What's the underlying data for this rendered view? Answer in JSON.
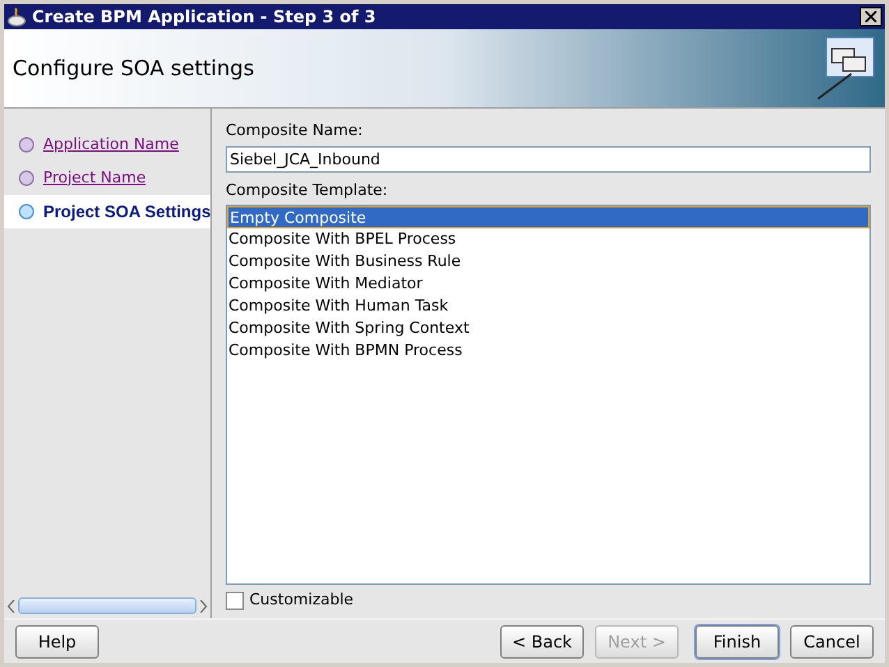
{
  "window": {
    "title": "Create BPM Application - Step 3 of 3"
  },
  "header": {
    "title": "Configure SOA settings"
  },
  "steps": [
    {
      "label": "Application Name",
      "selected": false
    },
    {
      "label": "Project Name",
      "selected": false
    },
    {
      "label": "Project SOA Settings",
      "selected": true
    }
  ],
  "composite_name": {
    "label": "Composite Name:",
    "value": "Siebel_JCA_Inbound"
  },
  "composite_template": {
    "label": "Composite Template:",
    "items": [
      {
        "label": "Empty Composite",
        "selected": true
      },
      {
        "label": "Composite With BPEL Process",
        "selected": false
      },
      {
        "label": "Composite With Business Rule",
        "selected": false
      },
      {
        "label": "Composite With Mediator",
        "selected": false
      },
      {
        "label": "Composite With Human Task",
        "selected": false
      },
      {
        "label": "Composite With Spring Context",
        "selected": false
      },
      {
        "label": "Composite With BPMN Process",
        "selected": false
      }
    ]
  },
  "customizable": {
    "label": "Customizable",
    "checked": false
  },
  "buttons": [
    {
      "label": "Help",
      "disabled": false,
      "default": false
    },
    {
      "label": "< Back",
      "disabled": false,
      "default": false
    },
    {
      "label": "Next >",
      "disabled": true,
      "default": false
    },
    {
      "label": "Finish",
      "disabled": false,
      "default": true
    },
    {
      "label": "Cancel",
      "disabled": false,
      "default": false
    }
  ]
}
